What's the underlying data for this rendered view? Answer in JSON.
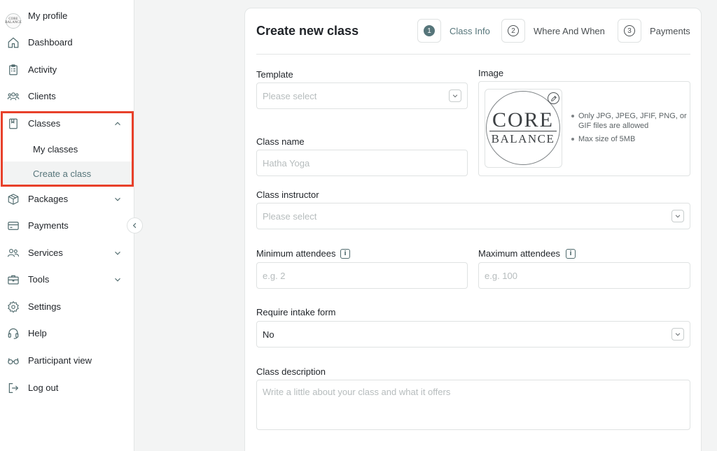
{
  "sidebar": {
    "profile": {
      "label": "My profile",
      "avatar_text": "CORE BALANCE"
    },
    "items": [
      {
        "label": "Dashboard",
        "icon": "home-icon"
      },
      {
        "label": "Activity",
        "icon": "clipboard-icon"
      },
      {
        "label": "Clients",
        "icon": "users-group-icon"
      },
      {
        "label": "Classes",
        "icon": "book-icon",
        "expanded": true
      },
      {
        "label": "Packages",
        "icon": "box-icon"
      },
      {
        "label": "Payments",
        "icon": "credit-card-icon"
      },
      {
        "label": "Services",
        "icon": "people-icon"
      },
      {
        "label": "Tools",
        "icon": "briefcase-icon"
      },
      {
        "label": "Settings",
        "icon": "gear-icon"
      },
      {
        "label": "Help",
        "icon": "headset-icon"
      },
      {
        "label": "Participant view",
        "icon": "glasses-icon"
      },
      {
        "label": "Log out",
        "icon": "logout-icon"
      }
    ],
    "classes_sub": [
      {
        "label": "My classes"
      },
      {
        "label": "Create a class",
        "active": true
      }
    ],
    "highlight_color": "#e8402a"
  },
  "form": {
    "title": "Create new class",
    "steps": [
      {
        "num": "1",
        "label": "Class Info",
        "active": true
      },
      {
        "num": "2",
        "label": "Where And When"
      },
      {
        "num": "3",
        "label": "Payments"
      }
    ],
    "template": {
      "label": "Template",
      "placeholder": "Please select"
    },
    "image": {
      "label": "Image",
      "logo_line1": "CORE",
      "logo_line2": "BALANCE",
      "rules": [
        "Only JPG, JPEG, JFIF, PNG, or GIF files are allowed",
        "Max size of 5MB"
      ]
    },
    "class_name": {
      "label": "Class name",
      "placeholder": "Hatha Yoga"
    },
    "instructor": {
      "label": "Class instructor",
      "placeholder": "Please select"
    },
    "min_attendees": {
      "label": "Minimum attendees",
      "placeholder": "e.g. 2"
    },
    "max_attendees": {
      "label": "Maximum attendees",
      "placeholder": "e.g. 100"
    },
    "intake_form": {
      "label": "Require intake form",
      "value": "No"
    },
    "description": {
      "label": "Class description",
      "placeholder": "Write a little about your class and what it offers"
    },
    "info_glyph": "i"
  },
  "colors": {
    "accent": "#56757a",
    "border": "#dfe2e2",
    "placeholder": "#b6bcbd"
  }
}
